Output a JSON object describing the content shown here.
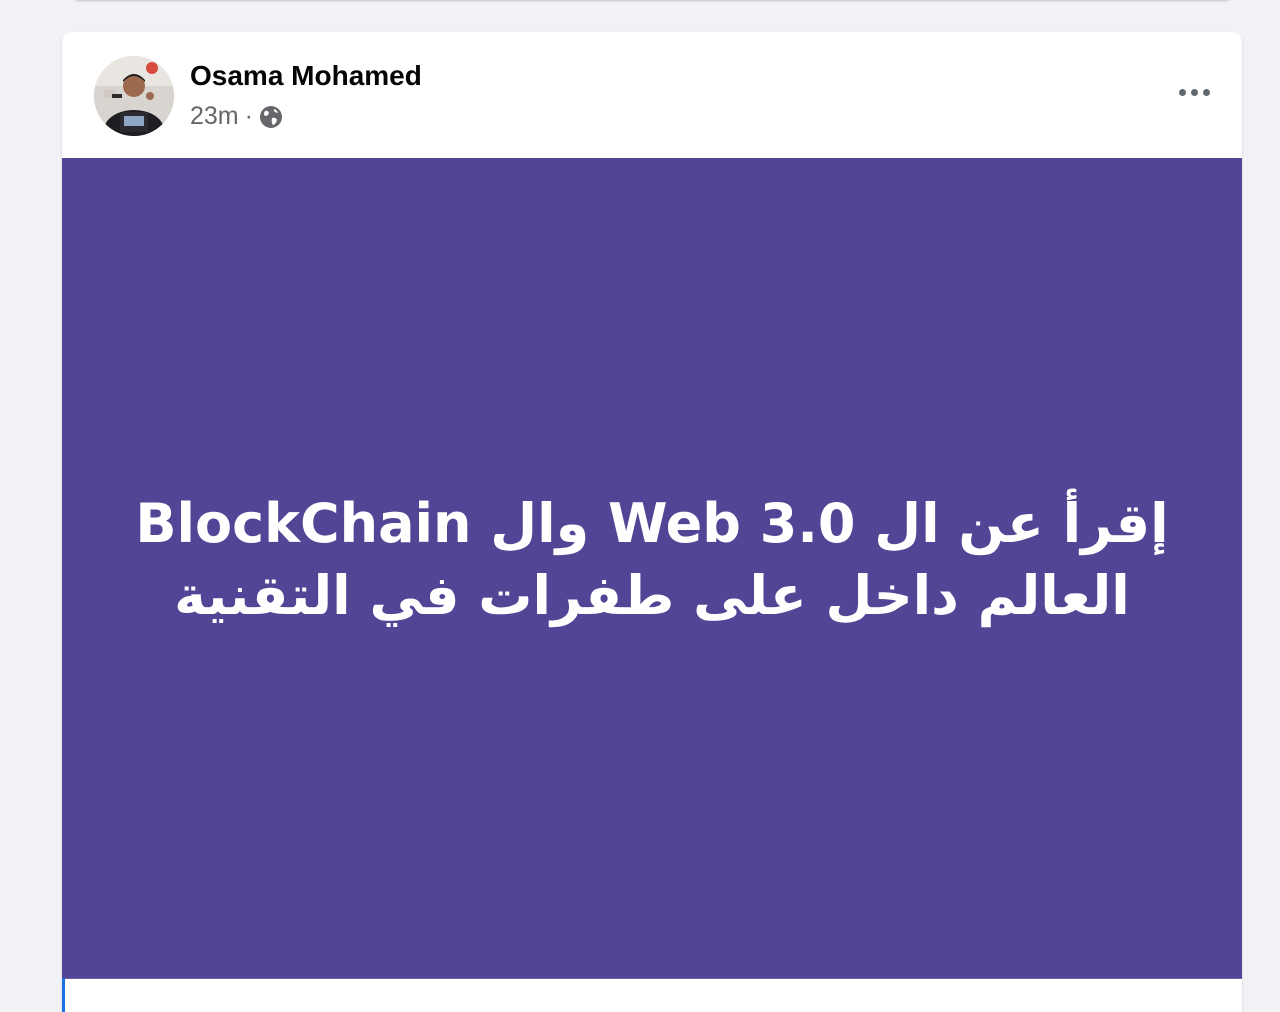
{
  "post": {
    "author": {
      "name": "Osama Mohamed",
      "avatar_icon": "profile-photo"
    },
    "timestamp": "23m",
    "separator": "·",
    "privacy_icon": "globe-icon",
    "more_icon": "more-options-icon",
    "background_color": "#514595",
    "text_lines": [
      "إقرأ عن ال Web 3.0 وال BlockChain",
      "العالم داخل على طفرات في التقنية"
    ]
  }
}
